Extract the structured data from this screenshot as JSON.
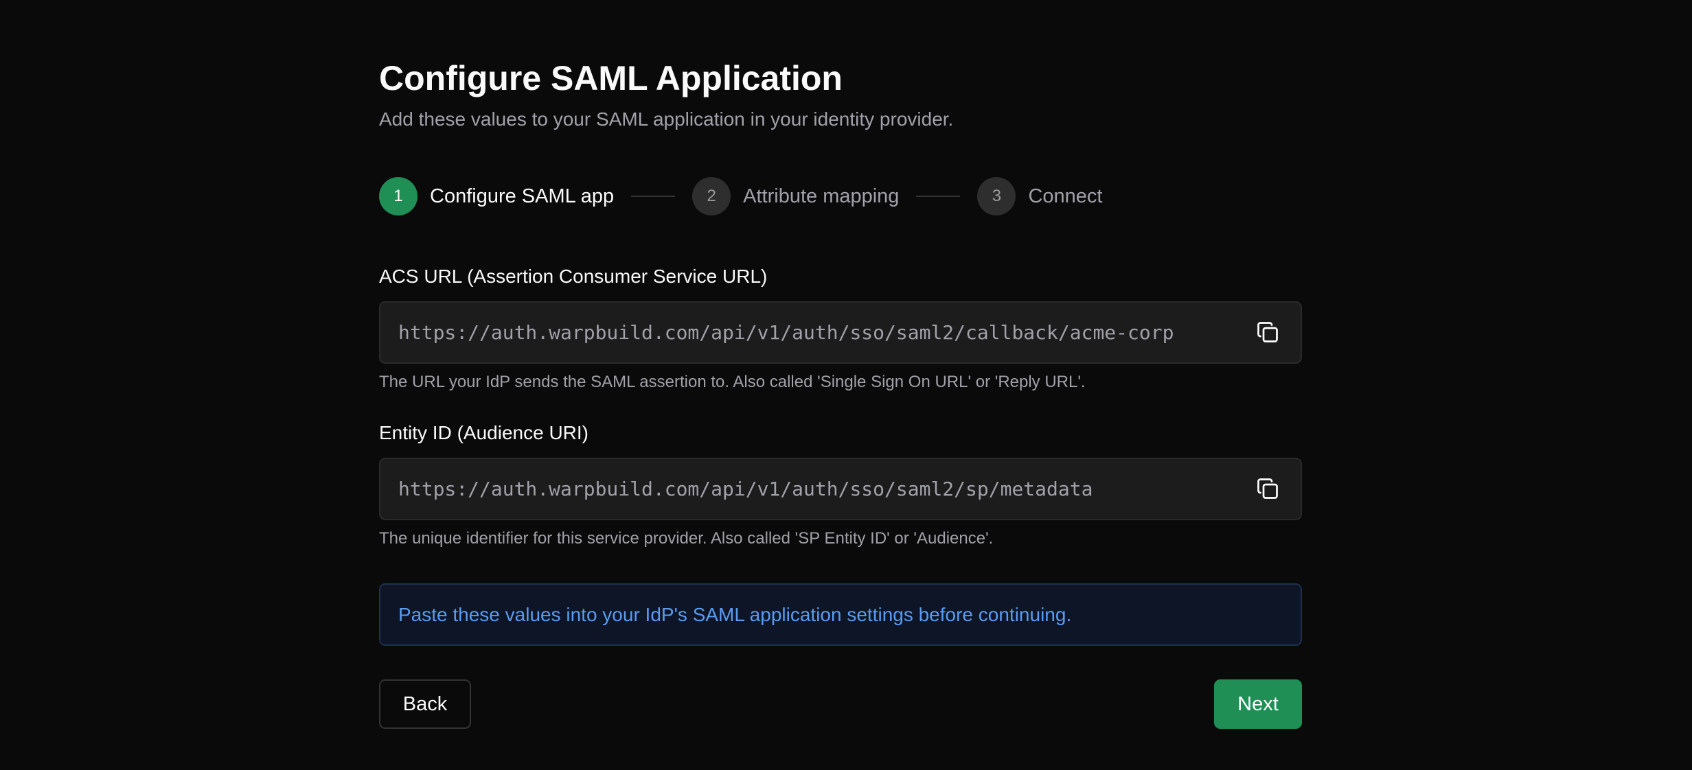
{
  "header": {
    "title": "Configure SAML Application",
    "subtitle": "Add these values to your SAML application in your identity provider."
  },
  "stepper": {
    "current_step": 1,
    "steps": [
      {
        "number": "1",
        "label": "Configure SAML app",
        "state": "active"
      },
      {
        "number": "2",
        "label": "Attribute mapping",
        "state": "inactive"
      },
      {
        "number": "3",
        "label": "Connect",
        "state": "inactive"
      }
    ]
  },
  "fields": {
    "acs": {
      "label": "ACS URL (Assertion Consumer Service URL)",
      "value": "https://auth.warpbuild.com/api/v1/auth/sso/saml2/callback/acme-corp",
      "help": "The URL your IdP sends the SAML assertion to. Also called 'Single Sign On URL' or 'Reply URL'.",
      "copy_icon": "copy-icon"
    },
    "entity": {
      "label": "Entity ID (Audience URI)",
      "value": "https://auth.warpbuild.com/api/v1/auth/sso/saml2/sp/metadata",
      "help": "The unique identifier for this service provider. Also called 'SP Entity ID' or 'Audience'.",
      "copy_icon": "copy-icon"
    }
  },
  "info": {
    "message": "Paste these values into your IdP's SAML application settings before continuing."
  },
  "actions": {
    "back_label": "Back",
    "next_label": "Next"
  },
  "colors": {
    "background": "#0a0a0a",
    "accent_green": "#1f8f55",
    "info_text": "#5b9bf0",
    "info_background": "#0d1526",
    "field_background": "#1c1c1c"
  }
}
